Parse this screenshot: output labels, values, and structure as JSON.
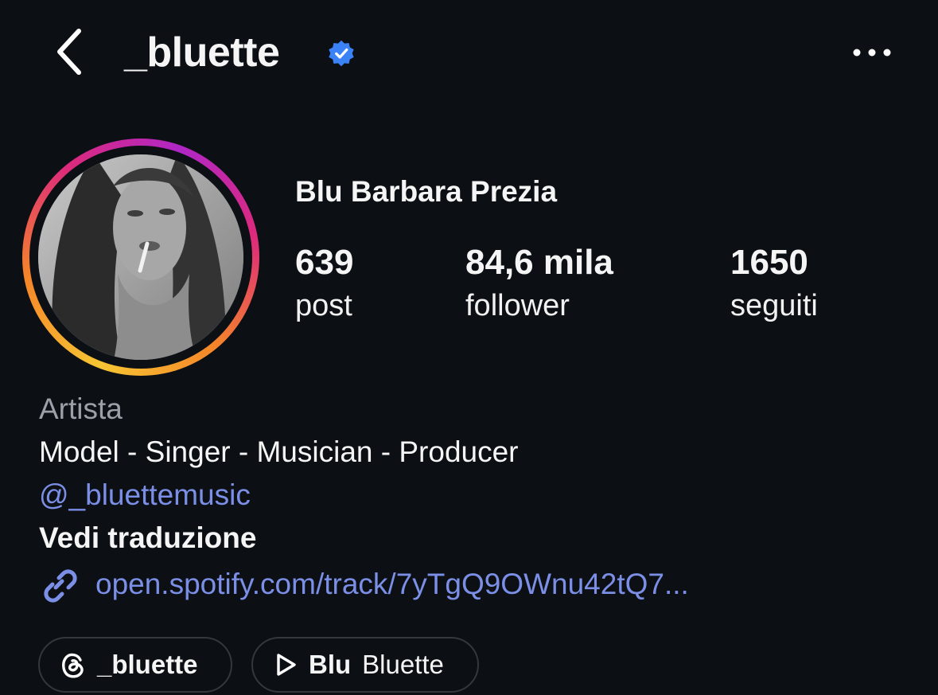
{
  "header": {
    "back_icon": "chevron-left-icon",
    "username": "_bluette",
    "verified_icon": "verified-badge-icon",
    "more_icon": "more-horizontal-icon"
  },
  "profile": {
    "full_name": "Blu Barbara Prezia",
    "stats": [
      {
        "value": "639",
        "label": "post"
      },
      {
        "value": "84,6 mila",
        "label": "follower"
      },
      {
        "value": "1650",
        "label": "seguiti"
      }
    ]
  },
  "bio": {
    "category": "Artista",
    "line1": "Model - Singer - Musician - Producer",
    "mention": "@_bluettemusic",
    "translate": "Vedi traduzione",
    "link_icon": "link-icon",
    "link": "open.spotify.com/track/7yTgQ9OWnu42tQ7..."
  },
  "chips": {
    "threads": {
      "icon": "threads-icon",
      "label": "_bluette"
    },
    "music": {
      "icon": "play-icon",
      "bold": "Blu",
      "label": "Bluette"
    }
  },
  "colors": {
    "background": "#0c0f14",
    "link_blue": "#7b8fe6",
    "verified_blue": "#3b82f6",
    "muted": "#9ca0a8"
  }
}
